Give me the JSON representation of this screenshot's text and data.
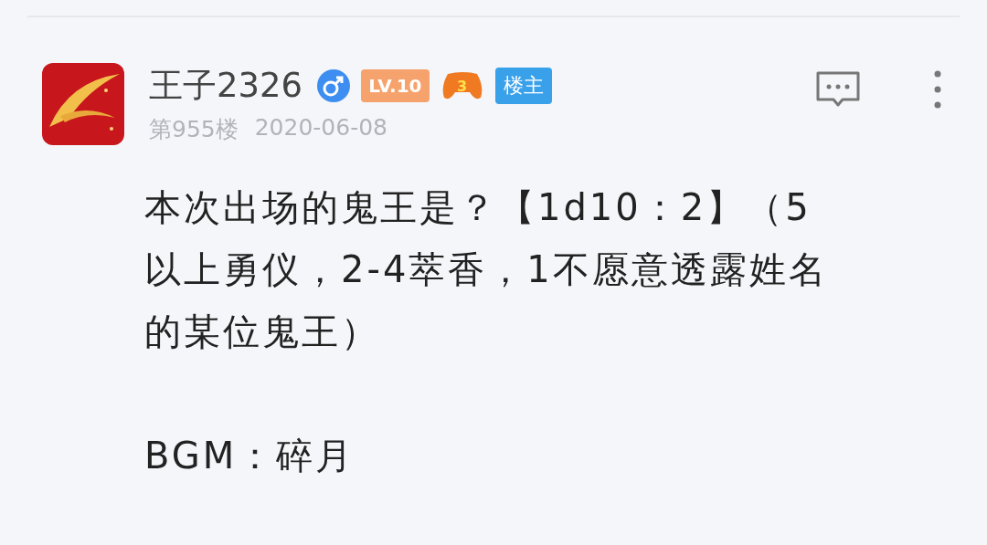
{
  "post": {
    "username": "王子2326",
    "male": true,
    "level_badge": "LV.10",
    "game_badge": "3",
    "owner_badge": "楼主",
    "floor": "第955楼",
    "date": "2020-06-08",
    "paragraphs": [
      "本次出场的鬼王是？【1d10：2】（5以上勇仪，2-4萃香，1不愿意透露姓名的某位鬼王）",
      "BGM：碎月"
    ]
  }
}
